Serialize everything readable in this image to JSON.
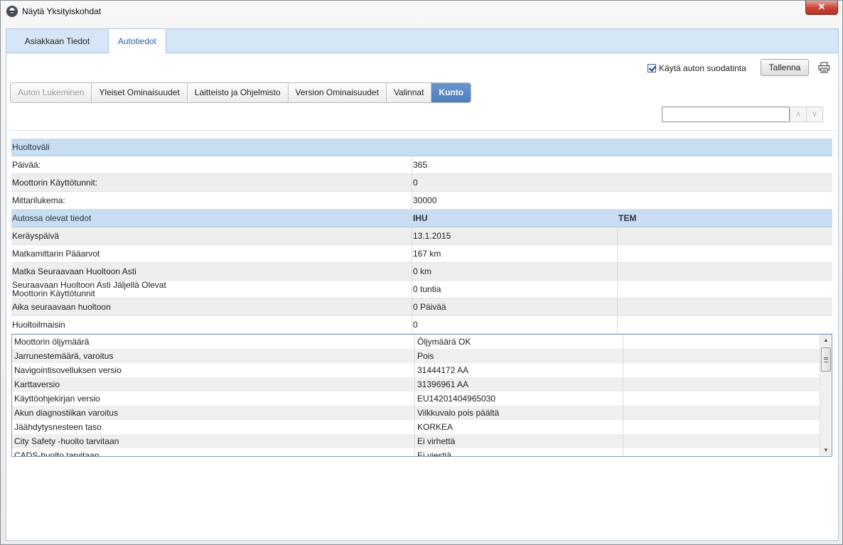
{
  "window": {
    "title": "Näytä Yksityiskohdat",
    "close_label": "✕"
  },
  "main_tabs": [
    {
      "label": "Asiakkaan Tiedot"
    },
    {
      "label": "Autotiedot"
    }
  ],
  "toolbar": {
    "filter_label": "Käytä auton suodatinta",
    "filter_checked": true,
    "save_label": "Tallenna"
  },
  "sub_tabs": [
    {
      "label": "Auton Lukeminen"
    },
    {
      "label": "Yleiset Ominaisuudet"
    },
    {
      "label": "Laitteisto ja Ohjelmisto"
    },
    {
      "label": "Version Ominaisuudet"
    },
    {
      "label": "Valinnat"
    },
    {
      "label": "Kunto"
    }
  ],
  "search": {
    "value": "",
    "placeholder": "",
    "up_label": "∧",
    "down_label": "∨"
  },
  "service_interval": {
    "header": "Huoltoväli",
    "rows": [
      {
        "label": "Päivää:",
        "value": "365"
      },
      {
        "label": "Moottorin Käyttötunnit:",
        "value": "0"
      },
      {
        "label": "Mittarilukema:",
        "value": "30000"
      }
    ]
  },
  "vehicle_data": {
    "header": {
      "label": "Autossa olevat tiedot",
      "col1": "IHU",
      "col2": "TEM"
    },
    "rows": [
      {
        "label": "Keräyspäivä",
        "ihu": "13.1.2015",
        "tem": ""
      },
      {
        "label": "Matkamittarin Pääarvot",
        "ihu": "167 km",
        "tem": ""
      },
      {
        "label": "Matka Seuraavaan Huoltoon Asti",
        "ihu": "0 km",
        "tem": ""
      },
      {
        "label": "Seuraavaan Huoltoon Asti Jäljellä Olevat Moottorin Käyttötunnit",
        "ihu": "0 tuntia",
        "tem": ""
      },
      {
        "label": "Aika seuraavaan huoltoon",
        "ihu": "0 Päivää",
        "tem": ""
      },
      {
        "label": "Huoltoilmaisin",
        "ihu": "0",
        "tem": ""
      }
    ]
  },
  "status_list": [
    {
      "label": "Moottorin öljymäärä",
      "value": "Öljymäärä OK"
    },
    {
      "label": "Jarrunestemäärä, varoitus",
      "value": "Pois"
    },
    {
      "label": "Navigointisovelluksen versio",
      "value": "31444172 AA"
    },
    {
      "label": "Karttaversio",
      "value": "31396961 AA"
    },
    {
      "label": "Käyttöohjekirjan versio",
      "value": "EU14201404965030"
    },
    {
      "label": "Akun diagnostiikan varoitus",
      "value": "Vilkkuvalo pois päältä"
    },
    {
      "label": "Jäähdytysnesteen taso",
      "value": "KORKEA"
    },
    {
      "label": "City Safety -huolto tarvitaan",
      "value": "Ei virhettä"
    },
    {
      "label": "CADS-huolto tarvitaan",
      "value": "Ei viestiä"
    }
  ],
  "colors": {
    "header_blue": "#c8dcf2",
    "tab_strip": "#d5e6f6",
    "active_tab": "#4c7dbd",
    "close_red": "#c9473a"
  },
  "icons": {
    "app": "volvo-logo-icon",
    "print": "printer-icon"
  }
}
